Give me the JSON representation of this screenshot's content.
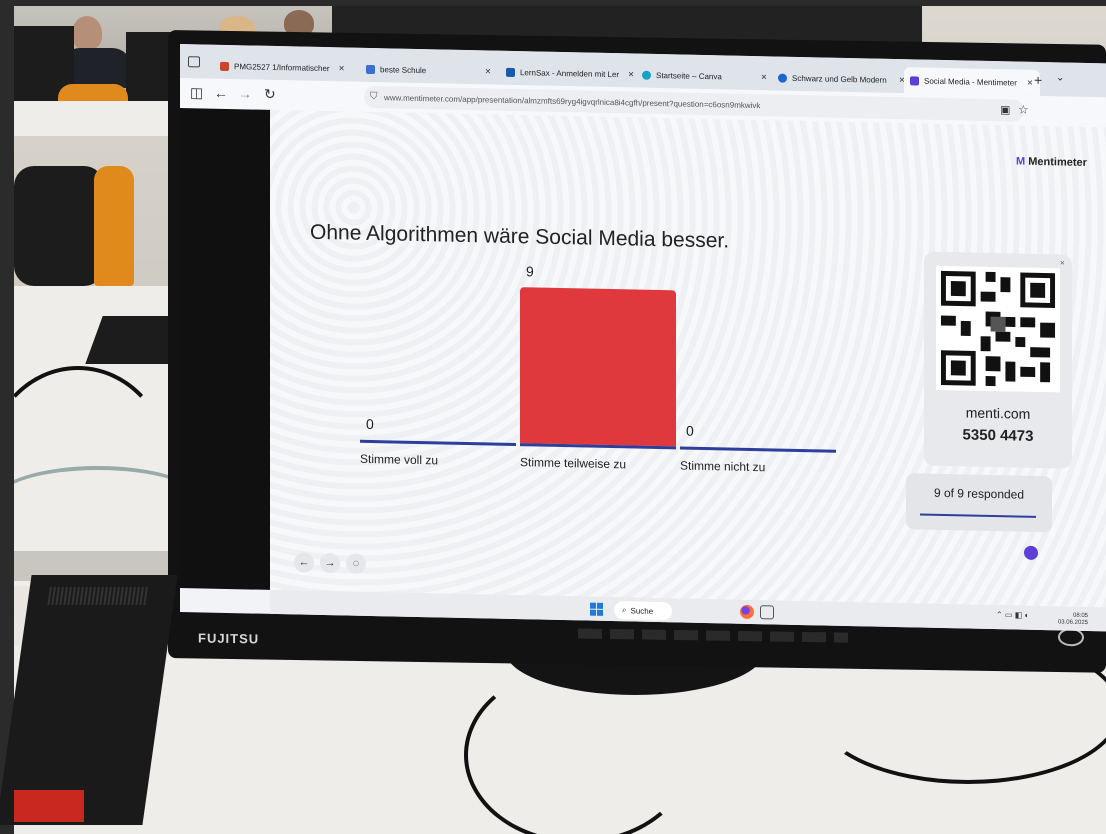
{
  "browser": {
    "tabs": [
      {
        "label": "PMG2527 1/Informatischer",
        "color": "#c8462b"
      },
      {
        "label": "beste Schule",
        "color": "#3b6fd1"
      },
      {
        "label": "LernSax - Anmelden mit Ler",
        "color": "#1c5aa8"
      },
      {
        "label": "Startseite – Canva",
        "color": "#16a1c9"
      },
      {
        "label": "Schwarz und Gelb Modern",
        "color": "#1a66cc"
      },
      {
        "label": "Social Media - Mentimeter",
        "color": "#5b3fd6"
      }
    ],
    "new_tab": "+",
    "tab_close": "×",
    "url": "www.mentimeter.com/app/presentation/almzmfts69ryg4igvqrlnica8i4cgfh/present?question=c6osn9mkwivk"
  },
  "presentation": {
    "logo_text": "Mentimeter",
    "question": "Ohne Algorithmen wäre Social Media besser.",
    "join": {
      "site": "menti.com",
      "code": "5350 4473"
    },
    "responded": "9 of 9 responded"
  },
  "chart_data": {
    "type": "bar",
    "categories": [
      "Stimme voll zu",
      "Stimme teilweise zu",
      "Stimme nicht zu"
    ],
    "values": [
      0,
      9,
      0
    ],
    "color": "#e0393d",
    "baseline_color": "#2d3e9d"
  },
  "taskbar": {
    "search_label": "Suche",
    "time": "08:05",
    "date": "03.06.2025"
  },
  "monitor": {
    "brand": "FUJITSU"
  }
}
